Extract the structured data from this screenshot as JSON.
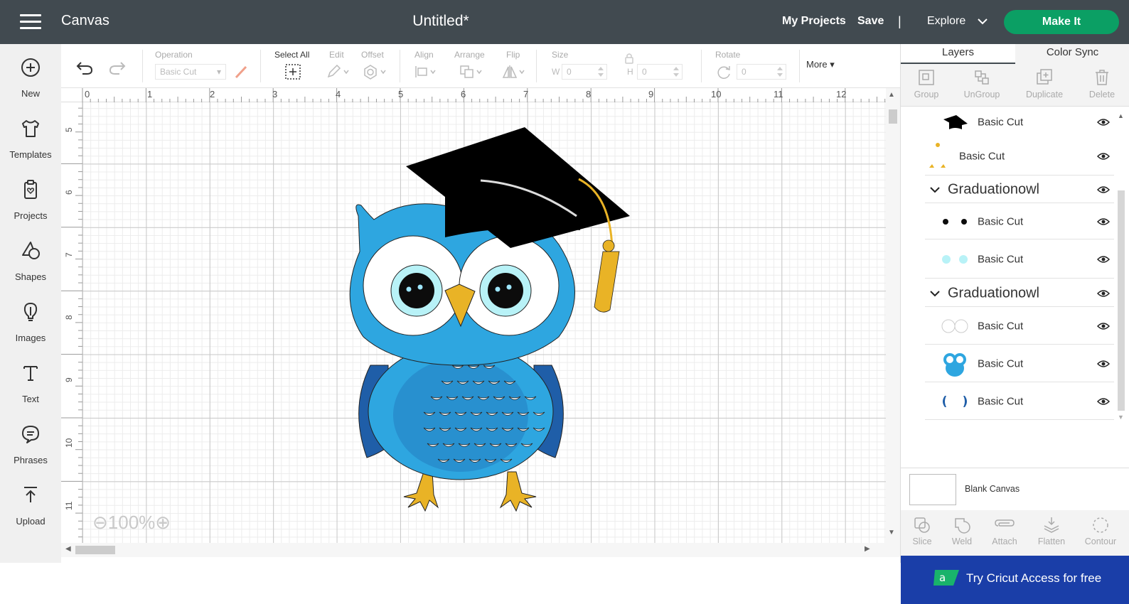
{
  "header": {
    "app_title": "Canvas",
    "doc_title": "Untitled*",
    "my_projects": "My Projects",
    "save": "Save",
    "separator": "|",
    "explore": "Explore",
    "make_it": "Make It",
    "make_it_color": "#0b9f64"
  },
  "sidebar": {
    "items": [
      {
        "label": "New",
        "icon": "plus-circle-icon"
      },
      {
        "label": "Templates",
        "icon": "tshirt-icon"
      },
      {
        "label": "Projects",
        "icon": "clipboard-heart-icon"
      },
      {
        "label": "Shapes",
        "icon": "shapes-icon"
      },
      {
        "label": "Images",
        "icon": "lightbulb-icon"
      },
      {
        "label": "Text",
        "icon": "text-t-icon"
      },
      {
        "label": "Phrases",
        "icon": "speech-bubble-icon"
      },
      {
        "label": "Upload",
        "icon": "upload-icon"
      }
    ]
  },
  "toolbar": {
    "operation_label": "Operation",
    "operation_value": "Basic Cut",
    "select_all": "Select All",
    "edit": "Edit",
    "offset": "Offset",
    "align": "Align",
    "arrange": "Arrange",
    "flip": "Flip",
    "size": "Size",
    "w_label": "W",
    "w_value": "0",
    "h_label": "H",
    "h_value": "0",
    "rotate": "Rotate",
    "rotate_value": "0",
    "more": "More"
  },
  "canvas": {
    "h_ruler": [
      "0",
      "1",
      "2",
      "3",
      "4",
      "5",
      "6",
      "7",
      "8",
      "9",
      "10",
      "11",
      "12"
    ],
    "v_ruler": [
      "5",
      "6",
      "7",
      "8",
      "9",
      "10",
      "11"
    ],
    "zoom": "100%",
    "image": "graduation-owl"
  },
  "right_panel": {
    "tabs": [
      "Layers",
      "Color Sync"
    ],
    "layer_tools": [
      "Group",
      "UnGroup",
      "Duplicate",
      "Delete"
    ],
    "layers": [
      {
        "type": "item",
        "name": "Basic Cut",
        "thumb": "cap"
      },
      {
        "type": "item",
        "name": "Basic Cut",
        "thumb": "tassel-dots"
      },
      {
        "type": "group",
        "name": "Graduationowl"
      },
      {
        "type": "item",
        "name": "Basic Cut",
        "thumb": "pupils"
      },
      {
        "type": "item",
        "name": "Basic Cut",
        "thumb": "iris"
      },
      {
        "type": "group",
        "name": "Graduationowl"
      },
      {
        "type": "item",
        "name": "Basic Cut",
        "thumb": "eye-whites"
      },
      {
        "type": "item",
        "name": "Basic Cut",
        "thumb": "owl-body"
      },
      {
        "type": "item",
        "name": "Basic Cut",
        "thumb": "wings"
      }
    ],
    "blank_canvas": "Blank Canvas",
    "bottom_tools": [
      "Slice",
      "Weld",
      "Attach",
      "Flatten",
      "Contour"
    ],
    "cricut_access": "Try Cricut Access for free"
  }
}
